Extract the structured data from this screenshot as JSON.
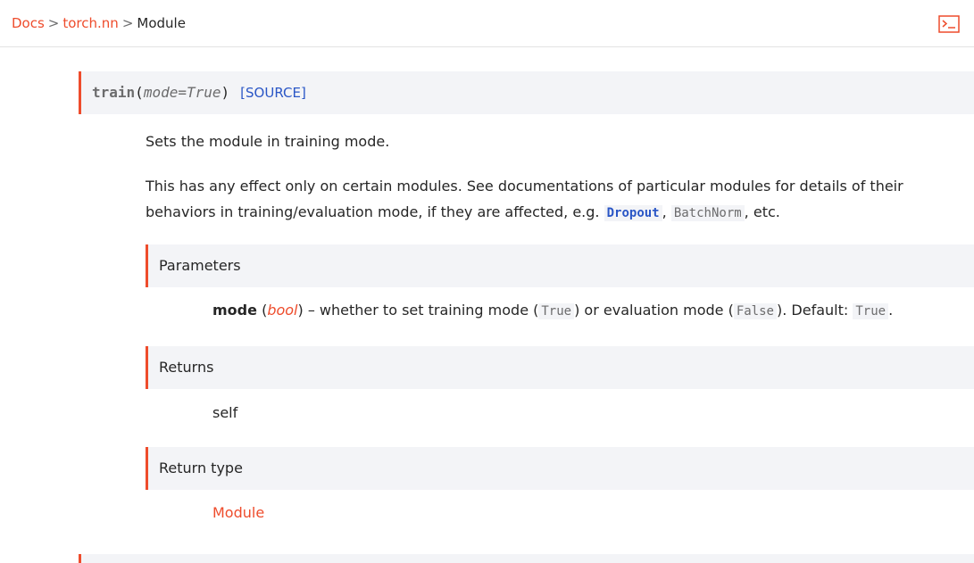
{
  "breadcrumb": {
    "items": [
      {
        "label": "Docs"
      },
      {
        "label": "torch.nn"
      },
      {
        "label": "Module"
      }
    ],
    "separator": ">"
  },
  "header": {
    "terminal_icon": "terminal-icon"
  },
  "signature": {
    "name": "train",
    "open": "(",
    "param": "mode=True",
    "close": ")",
    "source_label": "[SOURCE]"
  },
  "description": {
    "line1": "Sets the module in training mode.",
    "p2_text": "This has any effect only on certain modules. See documentations of particular modules for details of their behaviors in training/evaluation mode, if they are affected, e.g.",
    "dropout": "Dropout",
    "comma": ",",
    "batchnorm": "BatchNorm",
    "etc": ", etc."
  },
  "parameters": {
    "header": "Parameters",
    "name": "mode",
    "type_open": "(",
    "type": "bool",
    "type_close": ")",
    "desc_a": " – whether to set training mode (",
    "true_code": "True",
    "desc_b": ") or evaluation mode (",
    "false_code": "False",
    "desc_c": "). Default: ",
    "default_code": "True",
    "end": "."
  },
  "returns": {
    "header": "Returns",
    "value": "self"
  },
  "return_type": {
    "header": "Return type",
    "value": "Module"
  },
  "colors": {
    "accent": "#ee4c2c",
    "link_blue": "#2a56c6",
    "box_bg": "#f3f4f7"
  }
}
